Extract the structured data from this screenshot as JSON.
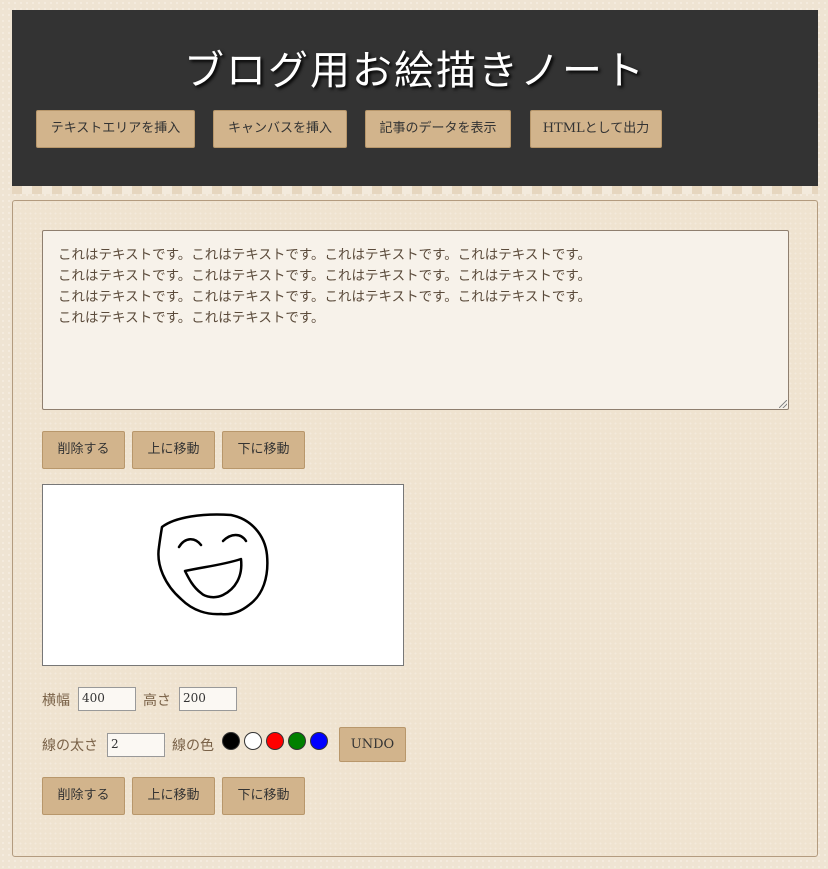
{
  "header": {
    "title": "ブログ用お絵描きノート",
    "buttons": [
      "テキストエリアを挿入",
      "キャンバスを挿入",
      "記事のデータを表示",
      "HTMLとして出力"
    ]
  },
  "textarea": {
    "value": "これはテキストです。これはテキストです。これはテキストです。これはテキストです。\nこれはテキストです。これはテキストです。これはテキストです。これはテキストです。\nこれはテキストです。これはテキストです。これはテキストです。これはテキストです。\nこれはテキストです。これはテキストです。"
  },
  "block_buttons": {
    "delete": "削除する",
    "up": "上に移動",
    "down": "下に移動"
  },
  "canvas_controls": {
    "width_label": "横幅",
    "width_value": "400",
    "height_label": "高さ",
    "height_value": "200",
    "line_width_label": "線の太さ",
    "line_width_value": "2",
    "line_color_label": "線の色",
    "colors": [
      "#000000",
      "#ffffff",
      "#ff0000",
      "#008000",
      "#0000ff"
    ],
    "undo_label": "UNDO"
  }
}
